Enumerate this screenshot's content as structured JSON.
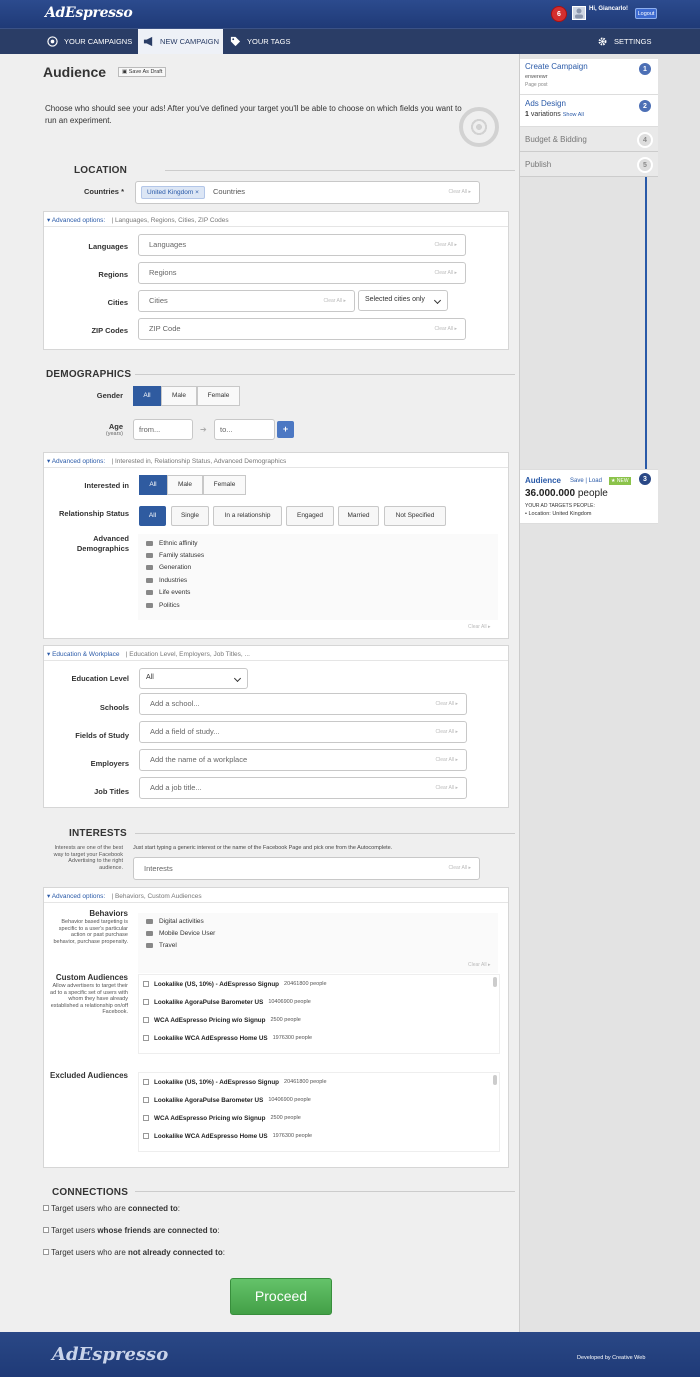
{
  "header": {
    "logo": "AdEspresso",
    "notifications": "6",
    "greeting": "Hi, Giancarlo!",
    "logout": "Logout"
  },
  "nav": {
    "campaigns": "YOUR CAMPAIGNS",
    "new_campaign": "NEW CAMPAIGN",
    "tags": "YOUR TAGS",
    "settings": "SETTINGS"
  },
  "page": {
    "title": "Audience",
    "save_draft": "Save As Draft",
    "intro": "Choose who should see your ads! After you've defined your target you'll be able to choose on which fields you want to run an experiment."
  },
  "location": {
    "heading": "LOCATION",
    "countries_label": "Countries",
    "required_mark": "*",
    "tag": "United Kingdom",
    "tag_remove": "×",
    "countries_placeholder": "Countries",
    "clear_all": "Clear All",
    "adv_title": "Advanced options:",
    "adv_sub": "Languages, Regions, Cities, ZIP Codes",
    "languages_label": "Languages",
    "languages_placeholder": "Languages",
    "regions_label": "Regions",
    "regions_placeholder": "Regions",
    "cities_label": "Cities",
    "cities_placeholder": "Cities",
    "cities_mode": "Selected cities only",
    "zip_label": "ZIP Codes",
    "zip_placeholder": "ZIP Code"
  },
  "demographics": {
    "heading": "DEMOGRAPHICS",
    "gender_label": "Gender",
    "gender": [
      "All",
      "Male",
      "Female"
    ],
    "age_label": "Age",
    "age_sub": "(years)",
    "age_from": "from...",
    "age_to": "to...",
    "age_add": "+",
    "adv_title": "Advanced options:",
    "adv_sub": "Interested in, Relationship Status, Advanced Demographics",
    "interested_label": "Interested in",
    "interested": [
      "All",
      "Male",
      "Female"
    ],
    "relationship_label": "Relationship Status",
    "relationship": [
      "All",
      "Single",
      "In a relationship",
      "Engaged",
      "Married",
      "Not Specified"
    ],
    "advdemo_label": "Advanced Demographics",
    "advdemo_items": [
      "Ethnic affinity",
      "Family statuses",
      "Generation",
      "Industries",
      "Life events",
      "Politics"
    ],
    "clear_all": "Clear All"
  },
  "education": {
    "title": "Education & Workplace",
    "sub": "Education Level, Employers, Job Titles, ...",
    "level_label": "Education Level",
    "level_value": "All",
    "schools_label": "Schools",
    "schools_placeholder": "Add a school...",
    "study_label": "Fields of Study",
    "study_placeholder": "Add a field of study...",
    "employers_label": "Employers",
    "employers_placeholder": "Add the name of a workplace",
    "jobs_label": "Job Titles",
    "jobs_placeholder": "Add a job title...",
    "clear_all": "Clear All"
  },
  "interests": {
    "heading": "INTERESTS",
    "desc": "Interests are one of the best way to target your Facebook Advertising to the right audience.",
    "hint": "Just start typing a generic interest or the name of the Facebook Page and pick one from the Autocomplete.",
    "placeholder": "Interests",
    "clear_all": "Clear All",
    "adv_title": "Advanced options:",
    "adv_sub": "Behaviors, Custom Audiences",
    "behaviors_label": "Behaviors",
    "behaviors_desc": "Behavior based targeting is specific to a user's particular action or past purchase behavior, purchase propensity.",
    "behaviors": [
      "Digital activities",
      "Mobile Device User",
      "Travel"
    ],
    "custom_label": "Custom Audiences",
    "custom_desc": "Allow advertisers to target their ad to a specific set of users with whom they have already established a relationship on/off Facebook.",
    "audiences": [
      {
        "name": "Lookalike (US, 10%) - AdEspresso Signup",
        "count": "20461800 people"
      },
      {
        "name": "Lookalike AgoraPulse Barometer US",
        "count": "10406900 people"
      },
      {
        "name": "WCA AdEspresso Pricing w/o Signup",
        "count": "2500 people"
      },
      {
        "name": "Lookalike WCA AdEspresso Home US",
        "count": "1976300 people"
      }
    ],
    "excluded_label": "Excluded Audiences"
  },
  "connections": {
    "heading": "CONNECTIONS",
    "opt1_pre": "Target users who are ",
    "opt1_bold": "connected to",
    "opt1_post": ":",
    "opt2_pre": "Target users ",
    "opt2_bold": "whose friends are connected to",
    "opt2_post": ":",
    "opt3_pre": "Target users who are ",
    "opt3_bold": "not already connected to",
    "opt3_post": ":"
  },
  "proceed": "Proceed",
  "sidebar": {
    "step1_title": "Create Campaign",
    "step1_sub1": "erwerewr",
    "step1_sub2": "Page post",
    "step1_num": "1",
    "step2_title": "Ads Design",
    "step2_count": "1",
    "step2_variations": " variations",
    "step2_show": "Show All",
    "step2_num": "2",
    "step3_title": "Budget & Bidding",
    "step3_num": "4",
    "step4_title": "Publish",
    "step4_num": "5",
    "audience_title": "Audience",
    "audience_save": "Save",
    "audience_sep": "|",
    "audience_load": "Load",
    "audience_new": "NEW",
    "audience_num": "3",
    "audience_count": "36.000.000",
    "audience_people": " people",
    "audience_targets": "YOUR AD TARGETS PEOPLE:",
    "audience_location": "Location: United Kingdom"
  },
  "footer": {
    "logo": "AdEspresso",
    "credit": "Developed by Creative Web"
  },
  "colors": {
    "brand_blue": "#2a3d66",
    "accent": "#2f5ba0",
    "proceed_green": "#4caf50",
    "notif_red": "#d32f2f"
  }
}
